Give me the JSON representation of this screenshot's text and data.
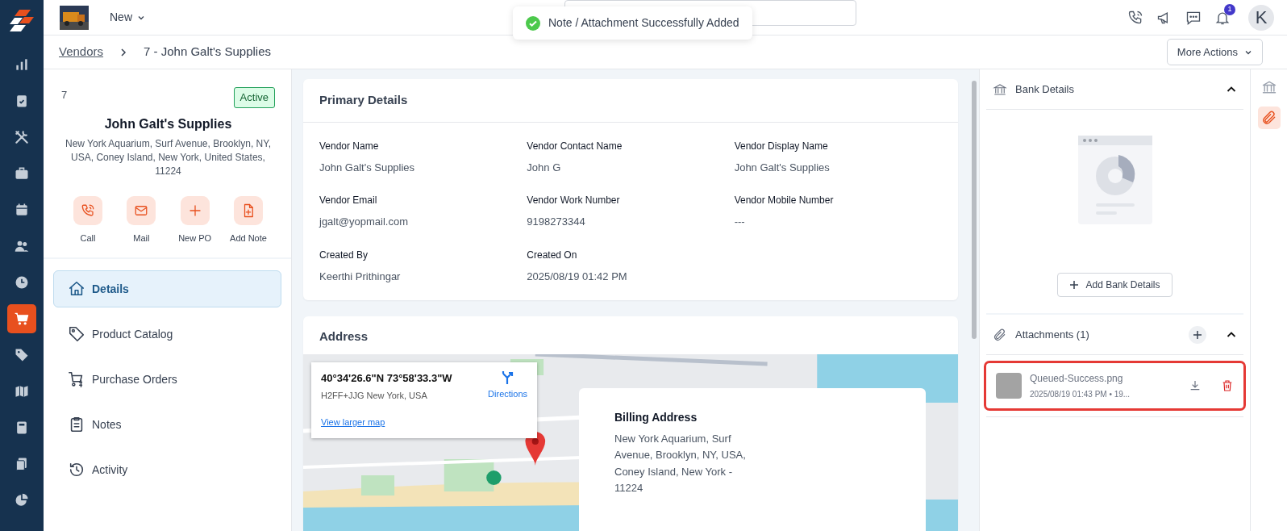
{
  "sidebar": {
    "items": [
      {
        "kind": "chart",
        "selected": false
      },
      {
        "kind": "clipboard",
        "selected": false
      },
      {
        "kind": "tools",
        "selected": false
      },
      {
        "kind": "briefcase",
        "selected": false
      },
      {
        "kind": "calendar",
        "selected": false
      },
      {
        "kind": "people",
        "selected": false
      },
      {
        "kind": "clock",
        "selected": false
      },
      {
        "kind": "cart",
        "selected": true
      },
      {
        "kind": "tag",
        "selected": false
      },
      {
        "kind": "map",
        "selected": false
      },
      {
        "kind": "calculator",
        "selected": false
      },
      {
        "kind": "documents",
        "selected": false
      },
      {
        "kind": "pie",
        "selected": false
      }
    ]
  },
  "topbar": {
    "new_menu": "New",
    "notification_count": "1",
    "avatar": "K"
  },
  "toast": {
    "message": "Note / Attachment Successfully Added"
  },
  "breadcrumb": {
    "items": [
      "Vendors",
      "7 - John Galt's Supplies"
    ],
    "more_actions": "More Actions"
  },
  "vendor": {
    "id": "7",
    "status": "Active",
    "name": "John Galt's Supplies",
    "address": "New York Aquarium, Surf Avenue, Brooklyn, NY, USA, Coney Island, New York, United States, 11224",
    "actions": [
      {
        "kind": "call",
        "label": "Call"
      },
      {
        "kind": "mail",
        "label": "Mail"
      },
      {
        "kind": "plus",
        "label": "New PO"
      },
      {
        "kind": "note",
        "label": "Add Note"
      }
    ]
  },
  "nav": {
    "items": [
      {
        "kind": "home",
        "label": "Details",
        "selected": true
      },
      {
        "kind": "tag",
        "label": "Product Catalog",
        "selected": false
      },
      {
        "kind": "cart",
        "label": "Purchase Orders",
        "selected": false
      },
      {
        "kind": "clipboard",
        "label": "Notes",
        "selected": false
      },
      {
        "kind": "history",
        "label": "Activity",
        "selected": false
      }
    ]
  },
  "primary_details": {
    "title": "Primary Details",
    "fields": [
      {
        "label": "Vendor Name",
        "value": "John Galt's Supplies"
      },
      {
        "label": "Vendor Contact Name",
        "value": "John G"
      },
      {
        "label": "Vendor Display Name",
        "value": "John Galt's Supplies"
      },
      {
        "label": "Vendor Email",
        "value": "jgalt@yopmail.com"
      },
      {
        "label": "Vendor Work Number",
        "value": "9198273344"
      },
      {
        "label": "Vendor Mobile Number",
        "value": "---"
      },
      {
        "label": "Created By",
        "value": "Keerthi Prithingar"
      },
      {
        "label": "Created On",
        "value": "2025/08/19 01:42 PM"
      }
    ]
  },
  "address": {
    "title": "Address",
    "map_card": {
      "coordinates": "40°34'26.6\"N 73°58'33.3\"W",
      "plus_code": "H2FF+JJG New York, USA",
      "directions": "Directions",
      "larger_map": "View larger map"
    },
    "billing": {
      "title": "Billing Address",
      "lines": [
        "New York Aquarium, Surf Avenue, Brooklyn, NY, USA,",
        "Coney Island, New York - 11224"
      ]
    }
  },
  "bank_details": {
    "title": "Bank Details",
    "expanded": true,
    "add_button": "Add Bank Details"
  },
  "attachments": {
    "title": "Attachments (1)",
    "expanded": true,
    "items": [
      {
        "name": "Queued-Success.png",
        "meta": "2025/08/19 01:43 PM • 19...",
        "highlighted": true
      }
    ]
  },
  "rail": {
    "items": [
      {
        "kind": "bank",
        "selected": false
      },
      {
        "kind": "attachment",
        "selected": true
      }
    ]
  }
}
